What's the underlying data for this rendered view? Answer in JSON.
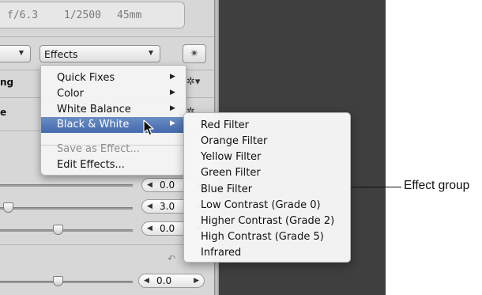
{
  "exif": {
    "aperture": "f/6.3",
    "shutter": "1/2500",
    "focal_length": "45mm"
  },
  "toolbar": {
    "effects_popup_label": "Effects",
    "left_popup_label": "",
    "magic_wand_icon": "magic-wand-icon"
  },
  "sections": {
    "row1_partial_label": "ng",
    "row2_partial_label": "e"
  },
  "effects_menu": {
    "items": [
      {
        "label": "Quick Fixes",
        "has_submenu": true
      },
      {
        "label": "Color",
        "has_submenu": true
      },
      {
        "label": "White Balance",
        "has_submenu": true
      },
      {
        "label": "Black & White",
        "has_submenu": true,
        "highlighted": true
      },
      {
        "label": "Save as Effect...",
        "disabled": true
      },
      {
        "label": "Edit Effects..."
      }
    ]
  },
  "bw_submenu": {
    "items": [
      "Red Filter",
      "Orange Filter",
      "Yellow Filter",
      "Green Filter",
      "Blue Filter",
      "Low Contrast (Grade 0)",
      "Higher Contrast (Grade 2)",
      "High Contrast (Grade 5)",
      "Infrared"
    ]
  },
  "sliders": [
    {
      "value": "0.0"
    },
    {
      "value": "3.0"
    },
    {
      "value": "0.0"
    },
    {
      "value": "0.0"
    }
  ],
  "callout": {
    "label": "Effect group"
  },
  "colors": {
    "highlight": "#4c72b4",
    "dark_area": "#3f3f3f"
  }
}
